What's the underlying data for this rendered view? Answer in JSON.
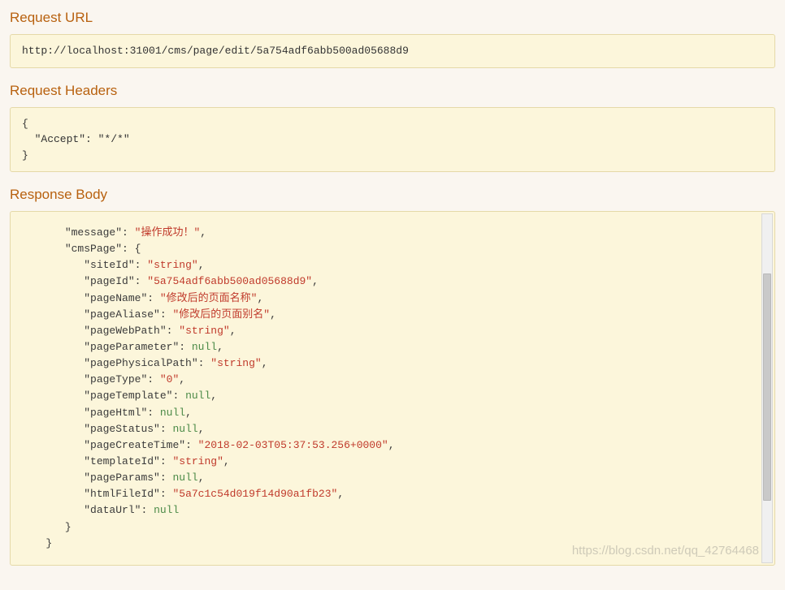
{
  "sections": {
    "request_url": {
      "title": "Request URL",
      "value": "http://localhost:31001/cms/page/edit/5a754adf6abb500ad05688d9"
    },
    "request_headers": {
      "title": "Request Headers",
      "lines": [
        "{",
        "  \"Accept\": \"*/*\"",
        "}"
      ]
    },
    "response_body": {
      "title": "Response Body",
      "json": [
        {
          "indent": 1,
          "type": "kv",
          "key": "message",
          "vtype": "string",
          "value": "操作成功！",
          "comma": true
        },
        {
          "indent": 1,
          "type": "kv",
          "key": "cmsPage",
          "vtype": "open",
          "value": "{",
          "comma": false
        },
        {
          "indent": 2,
          "type": "kv",
          "key": "siteId",
          "vtype": "string",
          "value": "string",
          "comma": true
        },
        {
          "indent": 2,
          "type": "kv",
          "key": "pageId",
          "vtype": "string",
          "value": "5a754adf6abb500ad05688d9",
          "comma": true
        },
        {
          "indent": 2,
          "type": "kv",
          "key": "pageName",
          "vtype": "string",
          "value": "修改后的页面名称",
          "comma": true
        },
        {
          "indent": 2,
          "type": "kv",
          "key": "pageAliase",
          "vtype": "string",
          "value": "修改后的页面别名",
          "comma": true
        },
        {
          "indent": 2,
          "type": "kv",
          "key": "pageWebPath",
          "vtype": "string",
          "value": "string",
          "comma": true
        },
        {
          "indent": 2,
          "type": "kv",
          "key": "pageParameter",
          "vtype": "null",
          "value": "null",
          "comma": true
        },
        {
          "indent": 2,
          "type": "kv",
          "key": "pagePhysicalPath",
          "vtype": "string",
          "value": "string",
          "comma": true
        },
        {
          "indent": 2,
          "type": "kv",
          "key": "pageType",
          "vtype": "string",
          "value": "0",
          "comma": true
        },
        {
          "indent": 2,
          "type": "kv",
          "key": "pageTemplate",
          "vtype": "null",
          "value": "null",
          "comma": true
        },
        {
          "indent": 2,
          "type": "kv",
          "key": "pageHtml",
          "vtype": "null",
          "value": "null",
          "comma": true
        },
        {
          "indent": 2,
          "type": "kv",
          "key": "pageStatus",
          "vtype": "null",
          "value": "null",
          "comma": true
        },
        {
          "indent": 2,
          "type": "kv",
          "key": "pageCreateTime",
          "vtype": "string",
          "value": "2018-02-03T05:37:53.256+0000",
          "comma": true
        },
        {
          "indent": 2,
          "type": "kv",
          "key": "templateId",
          "vtype": "string",
          "value": "string",
          "comma": true
        },
        {
          "indent": 2,
          "type": "kv",
          "key": "pageParams",
          "vtype": "null",
          "value": "null",
          "comma": true
        },
        {
          "indent": 2,
          "type": "kv",
          "key": "htmlFileId",
          "vtype": "string",
          "value": "5a7c1c54d019f14d90a1fb23",
          "comma": true
        },
        {
          "indent": 2,
          "type": "kv",
          "key": "dataUrl",
          "vtype": "null",
          "value": "null",
          "comma": false
        },
        {
          "indent": 1,
          "type": "close",
          "value": "}",
          "comma": false
        },
        {
          "indent": 0,
          "type": "close",
          "value": "}",
          "comma": false
        }
      ]
    }
  },
  "watermark": "https://blog.csdn.net/qq_42764468"
}
